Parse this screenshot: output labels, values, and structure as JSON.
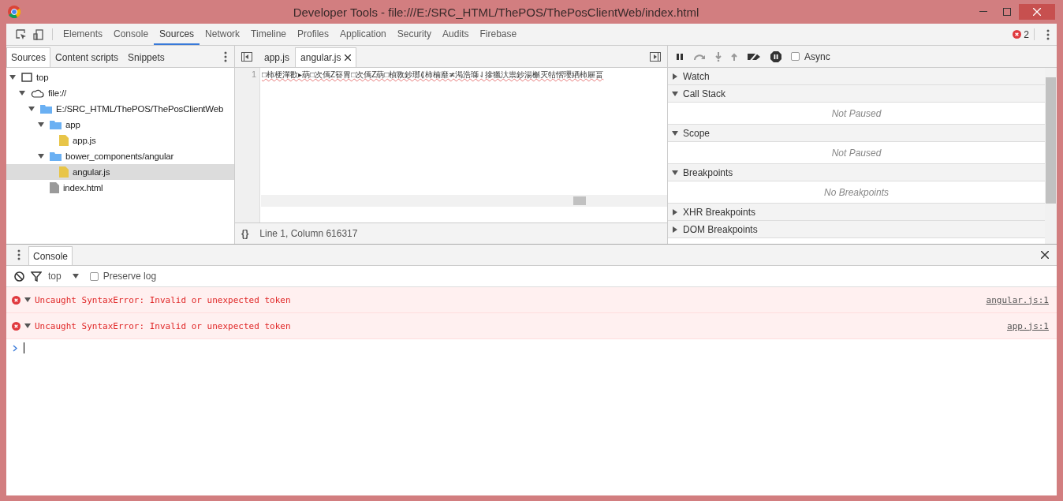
{
  "window": {
    "title": "Developer Tools - file:///E:/SRC_HTML/ThePOS/ThePosClientWeb/index.html"
  },
  "main_tabs": [
    {
      "label": "Elements",
      "selected": false
    },
    {
      "label": "Console",
      "selected": false
    },
    {
      "label": "Sources",
      "selected": true
    },
    {
      "label": "Network",
      "selected": false
    },
    {
      "label": "Timeline",
      "selected": false
    },
    {
      "label": "Profiles",
      "selected": false
    },
    {
      "label": "Application",
      "selected": false
    },
    {
      "label": "Security",
      "selected": false
    },
    {
      "label": "Audits",
      "selected": false
    },
    {
      "label": "Firebase",
      "selected": false
    }
  ],
  "error_count": "2",
  "navigator": {
    "tabs": [
      {
        "label": "Sources",
        "selected": true
      },
      {
        "label": "Content scripts",
        "selected": false
      },
      {
        "label": "Snippets",
        "selected": false
      }
    ],
    "tree": [
      {
        "label": "top",
        "kind": "frame",
        "expanded": true,
        "selected": false,
        "children": [
          {
            "label": "file://",
            "kind": "cloud",
            "expanded": true,
            "selected": false,
            "children": [
              {
                "label": "E:/SRC_HTML/ThePOS/ThePosClientWeb",
                "kind": "folder",
                "expanded": true,
                "selected": false,
                "children": [
                  {
                    "label": "app",
                    "kind": "folder",
                    "expanded": true,
                    "selected": false,
                    "children": [
                      {
                        "label": "app.js",
                        "kind": "script",
                        "selected": false
                      }
                    ]
                  },
                  {
                    "label": "bower_components/angular",
                    "kind": "folder",
                    "expanded": true,
                    "selected": false,
                    "children": [
                      {
                        "label": "angular.js",
                        "kind": "script",
                        "selected": true
                      }
                    ]
                  },
                  {
                    "label": "index.html",
                    "kind": "document",
                    "selected": false
                  }
                ]
              }
            ]
          }
        ]
      }
    ]
  },
  "editor": {
    "tabs": [
      {
        "label": "app.js",
        "selected": false,
        "closable": false
      },
      {
        "label": "angular.js",
        "selected": true,
        "closable": true
      }
    ],
    "line_number": "1",
    "code": "□柿梗潬歡▸蒳□次傿Z簮胃□次傿Z蒳□楨斁鈔瑯⟪柿楠靡≭渇浩瑡⇃摻獵汏祟鈔湯槲灭牯慴瓔絤柿屜畐",
    "format_button": "{}",
    "status": "Line 1, Column 616317"
  },
  "debugger": {
    "async": {
      "label": "Async",
      "checked": false
    },
    "sections": [
      {
        "title": "Watch",
        "expanded": false
      },
      {
        "title": "Call Stack",
        "expanded": true,
        "message": "Not Paused"
      },
      {
        "title": "Scope",
        "expanded": true,
        "message": "Not Paused"
      },
      {
        "title": "Breakpoints",
        "expanded": true,
        "message": "No Breakpoints"
      },
      {
        "title": "XHR Breakpoints",
        "expanded": false
      },
      {
        "title": "DOM Breakpoints",
        "expanded": false
      }
    ]
  },
  "console": {
    "tab": "Console",
    "context": "top",
    "preserve_log": {
      "label": "Preserve log",
      "checked": false
    },
    "messages": [
      {
        "text": "Uncaught SyntaxError: Invalid or unexpected token",
        "source": "angular.js:1",
        "expanded": true
      },
      {
        "text": "Uncaught SyntaxError: Invalid or unexpected token",
        "source": "app.js:1",
        "expanded": true
      }
    ]
  }
}
